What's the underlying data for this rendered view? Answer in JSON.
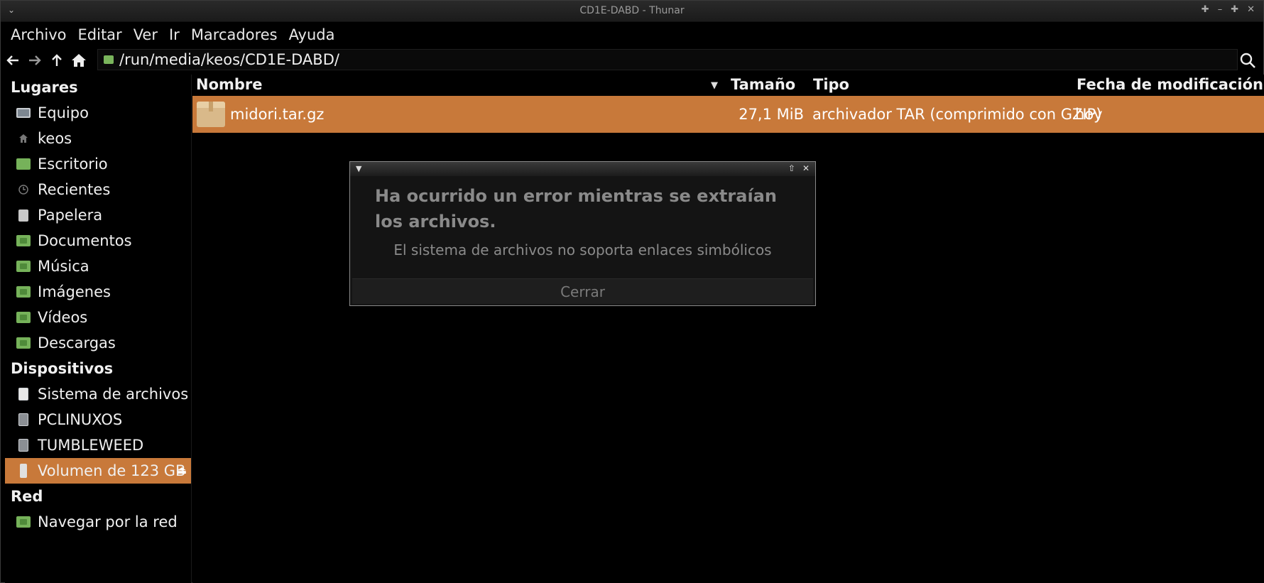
{
  "window": {
    "title": "CD1E-DABD - Thunar"
  },
  "menubar": {
    "items": [
      "Archivo",
      "Editar",
      "Ver",
      "Ir",
      "Marcadores",
      "Ayuda"
    ]
  },
  "toolbar": {
    "location_path": "/run/media/keos/CD1E-DABD/"
  },
  "sidebar": {
    "sections": [
      {
        "heading": "Lugares",
        "items": [
          {
            "label": "Equipo",
            "icon": "computer-icon"
          },
          {
            "label": "keos",
            "icon": "home-icon"
          },
          {
            "label": "Escritorio",
            "icon": "desktop-icon"
          },
          {
            "label": "Recientes",
            "icon": "clock-icon"
          },
          {
            "label": "Papelera",
            "icon": "trash-icon"
          },
          {
            "label": "Documentos",
            "icon": "folder-icon"
          },
          {
            "label": "Música",
            "icon": "folder-icon"
          },
          {
            "label": "Imágenes",
            "icon": "folder-icon"
          },
          {
            "label": "Vídeos",
            "icon": "folder-icon"
          },
          {
            "label": "Descargas",
            "icon": "folder-icon"
          }
        ]
      },
      {
        "heading": "Dispositivos",
        "items": [
          {
            "label": "Sistema de archivos",
            "icon": "drive-icon"
          },
          {
            "label": "PCLINUXOS",
            "icon": "drive-icon"
          },
          {
            "label": "TUMBLEWEED",
            "icon": "drive-icon"
          },
          {
            "label": "Volumen de 123 GB",
            "icon": "usb-icon",
            "active": true
          }
        ]
      },
      {
        "heading": "Red",
        "items": [
          {
            "label": "Navegar por la red",
            "icon": "network-folder-icon"
          }
        ]
      }
    ]
  },
  "filelist": {
    "columns": {
      "name": "Nombre",
      "size": "Tamaño",
      "type": "Tipo",
      "date": "Fecha de modificación"
    },
    "rows": [
      {
        "name": "midori.tar.gz",
        "size": "27,1 MiB",
        "type": "archivador TAR (comprimido con GZIP)",
        "date": "hoy",
        "selected": true
      }
    ]
  },
  "dialog": {
    "heading": "Ha ocurrido un error mientras se extraían los archivos.",
    "message": "El sistema de archivos no soporta enlaces simbólicos",
    "button": "Cerrar"
  },
  "colors": {
    "selection": "#c8793a",
    "folder": "#76b25a",
    "background": "#000000"
  }
}
